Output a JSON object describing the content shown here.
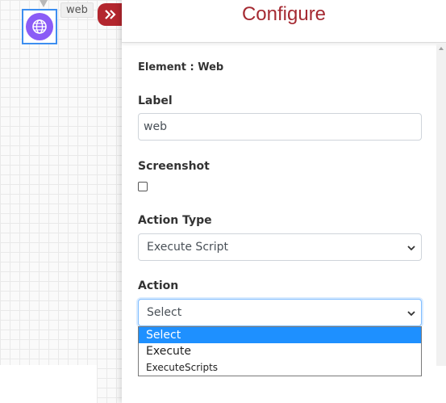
{
  "canvas": {
    "node": {
      "label": "web",
      "icon": "globe-icon",
      "color": "#8b5cf6"
    },
    "collapse_icon": "double-chevron-right-icon"
  },
  "panel": {
    "title": "Configure",
    "element_line": "Element : Web",
    "label_field": {
      "label": "Label",
      "value": "web"
    },
    "screenshot_field": {
      "label": "Screenshot",
      "checked": false
    },
    "action_type_field": {
      "label": "Action Type",
      "value": "Execute Script"
    },
    "action_field": {
      "label": "Action",
      "value": "Select",
      "options": [
        "Select",
        "Execute",
        "ExecuteScripts"
      ],
      "selected_index": 0
    }
  },
  "colors": {
    "accent": "#a52a32",
    "collapse_button": "#b3262e",
    "highlight": "#1e90ff"
  }
}
